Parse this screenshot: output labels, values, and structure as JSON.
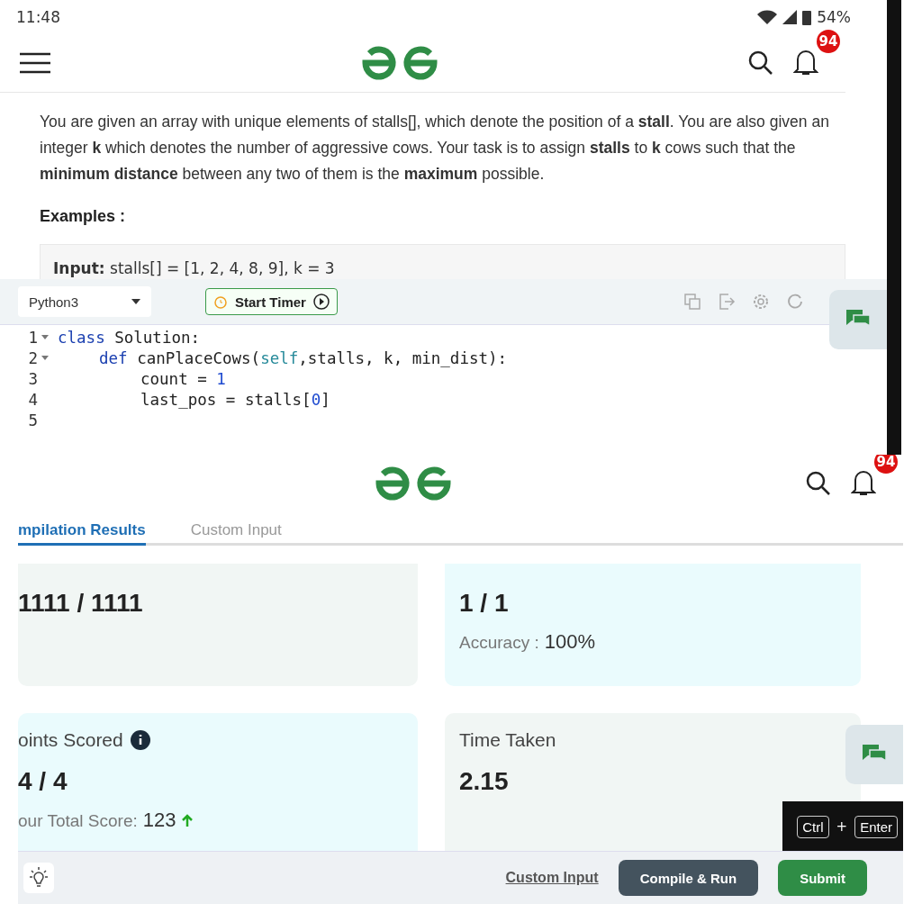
{
  "top_screen": {
    "status_bar": {
      "time": "11:48",
      "battery": "54%"
    },
    "notification_count": "94",
    "problem": {
      "paragraph": "You are given an array with unique elements of stalls[], which denote the position of a **stall**. You are also given an integer **k** which denotes the number of aggressive cows. Your task is to assign **stalls** to **k** cows such that the **minimum distance** between any two of them is the **maximum** possible.",
      "examples_heading": "Examples :",
      "example_input": "**Input:** stalls[] = [1, 2, 4, 8, 9], k = 3"
    },
    "editor": {
      "language": "Python3",
      "timer_button": "Start Timer",
      "lines": [
        {
          "number": "1",
          "foldable": true,
          "tokens": [
            {
              "text": "class",
              "kind": "keyword"
            },
            {
              "text": " Solution:",
              "kind": "plain"
            }
          ],
          "children": [
            {
              "number": "2",
              "foldable": true,
              "tokens": [
                {
                  "text": "def",
                  "kind": "keyword"
                },
                {
                  "text": " canPlaceCows(",
                  "kind": "plain"
                },
                {
                  "text": "self",
                  "kind": "builtin"
                },
                {
                  "text": ",stalls, k, min_dist):",
                  "kind": "plain"
                }
              ],
              "children": [
                {
                  "number": "3",
                  "foldable": false,
                  "tokens": [
                    {
                      "text": "count = ",
                      "kind": "plain"
                    },
                    {
                      "text": "1",
                      "kind": "number"
                    }
                  ]
                },
                {
                  "number": "4",
                  "foldable": false,
                  "tokens": [
                    {
                      "text": "last_pos = stalls[",
                      "kind": "plain"
                    },
                    {
                      "text": "0",
                      "kind": "number"
                    },
                    {
                      "text": "]",
                      "kind": "plain"
                    }
                  ]
                },
                {
                  "number": "5",
                  "foldable": false
                }
              ]
            }
          ]
        }
      ]
    }
  },
  "bottom_screen": {
    "notification_count": "94",
    "tabs": [
      {
        "label": "mpilation Results",
        "selected": true
      },
      {
        "label": "Custom Input",
        "selected": false
      }
    ],
    "cards": [
      {
        "color": "#f1f6f4",
        "value": "1111 / 1111"
      },
      {
        "color": "#eafbfd",
        "value": "1 / 1",
        "detail_label": "Accuracy :",
        "detail_value": "100%"
      },
      {
        "color": "#eafbfd",
        "title": "oints Scored",
        "info": true,
        "value": "4 / 4",
        "detail_label": "our Total Score:",
        "detail_value": "123",
        "trend_up": true
      },
      {
        "color": "#f1f6f4",
        "title": "Time Taken",
        "value": "2.15"
      }
    ],
    "shortcut": {
      "keys": [
        "Ctrl",
        "Enter"
      ],
      "joiner": "+"
    },
    "custom_input_link": "Custom Input",
    "compile_button": "Compile & Run",
    "submit_button": "Submit"
  }
}
